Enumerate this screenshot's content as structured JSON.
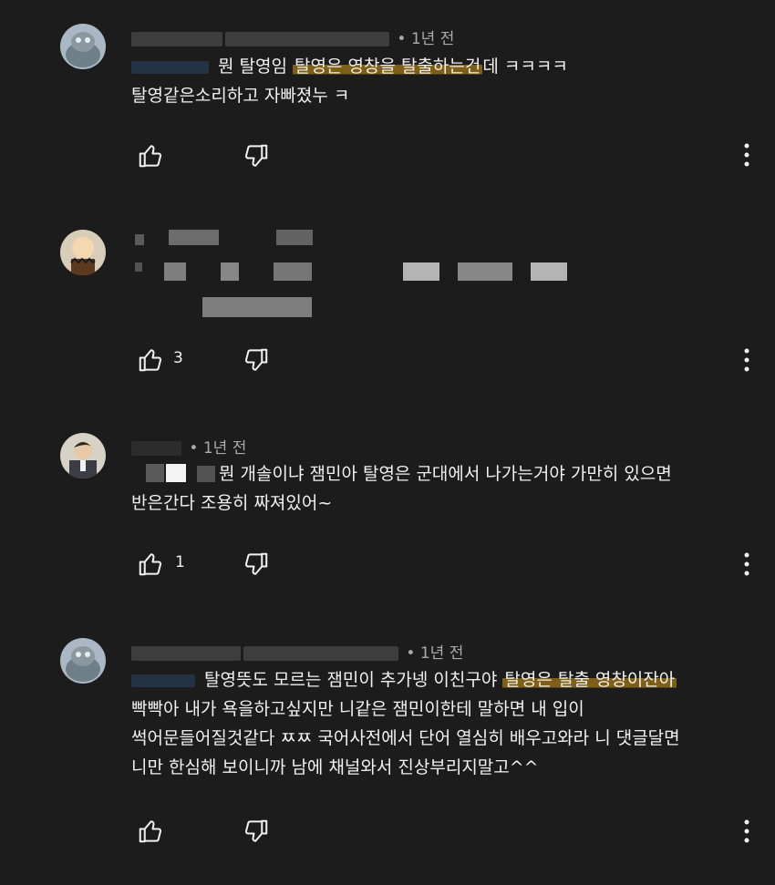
{
  "comments": [
    {
      "time": "• 1년 전",
      "text_before": "뭔 탈영임 ",
      "text_highlight": "탈영은 영창을 탈출하는건",
      "text_after": "데 ㅋㅋㅋㅋ",
      "line2": "탈영같은소리하고 자빠졌누 ㅋ",
      "likes": "",
      "avatar_icon": "avatar-cat-icon"
    },
    {
      "time": "",
      "likes": "3",
      "avatar_icon": "avatar-cartoon-icon"
    },
    {
      "time": "• 1년 전",
      "line1": "뭔 개솔이냐 잼민아 탈영은 군대에서 나가는거야  가만히 있으면",
      "line2": "반은간다 조용히 짜져있어~",
      "likes": "1",
      "avatar_icon": "avatar-person-icon"
    },
    {
      "time": "• 1년 전",
      "text_before": "탈영뜻도 모르는 잼민이 추가넹 이친구야 ",
      "text_highlight": "탈영은 탈출 영창이잔아",
      "line2": "빡빡아 내가 욕을하고싶지만 니같은 잼민이한테 말하면 내 입이",
      "line3": "썩어문들어질것같다 ㅉㅉ 국어사전에서 단어 열심히 배우고와라 니 댓글달면",
      "line4": "니만 한심해 보이니까 남에 채널와서 진상부리지말고^^",
      "likes": "",
      "avatar_icon": "avatar-cat-icon"
    }
  ],
  "colors": {
    "background": "#1c1c1c",
    "text": "#f1f1f1",
    "meta": "#aaaaaa",
    "highlight": "#ce9614"
  }
}
